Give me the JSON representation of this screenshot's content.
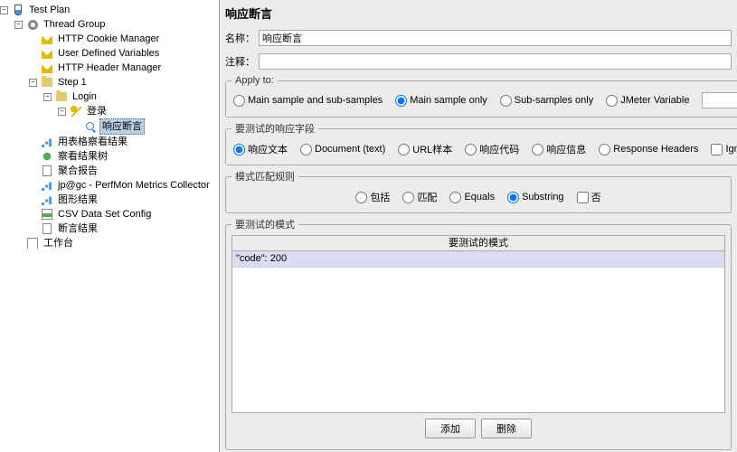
{
  "tree": {
    "root": "Test Plan",
    "threadGroup": "Thread Group",
    "cookieMgr": "HTTP Cookie Manager",
    "userVars": "User Defined Variables",
    "headerMgr": "HTTP Header Manager",
    "step1": "Step 1",
    "login": "Login",
    "loginReq": "登录",
    "respAssert": "响应断言",
    "tableView": "用表格察看结果",
    "treeView": "察看结果树",
    "aggReport": "聚合报告",
    "perfmon": "jp@gc - PerfMon Metrics Collector",
    "graphResults": "图形结果",
    "csvConfig": "CSV Data Set Config",
    "assertResults": "断言结果",
    "workbench": "工作台"
  },
  "panel": {
    "title": "响应断言",
    "nameLabel": "名称：",
    "nameValue": "响应断言",
    "commentLabel": "注释：",
    "commentValue": ""
  },
  "applyTo": {
    "legend": "Apply to:",
    "opt1": "Main sample and sub-samples",
    "opt2": "Main sample only",
    "opt3": "Sub-samples only",
    "opt4": "JMeter Variable"
  },
  "respField": {
    "legend": "要测试的响应字段",
    "opt1": "响应文本",
    "opt2": "Document (text)",
    "opt3": "URL样本",
    "opt4": "响应代码",
    "opt5": "响应信息",
    "opt6": "Response Headers",
    "ignore": "Ignore Status"
  },
  "matchRule": {
    "legend": "模式匹配规则",
    "opt1": "包括",
    "opt2": "匹配",
    "opt3": "Equals",
    "opt4": "Substring",
    "not": "否"
  },
  "patterns": {
    "legend": "要测试的模式",
    "columnHeader": "要测试的模式",
    "rows": [
      "\"code\": 200"
    ]
  },
  "buttons": {
    "add": "添加",
    "delete": "删除"
  }
}
